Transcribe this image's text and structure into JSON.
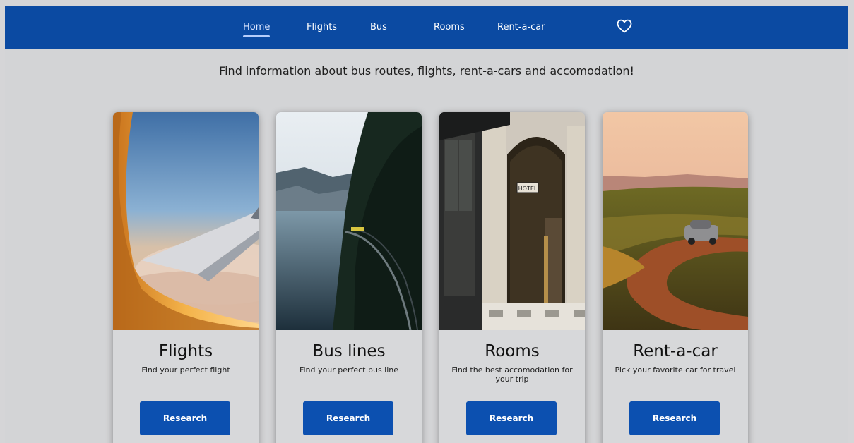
{
  "nav": {
    "items": [
      {
        "label": "Home",
        "active": true
      },
      {
        "label": "Flights",
        "active": false
      },
      {
        "label": "Bus",
        "active": false
      },
      {
        "label": "Rooms",
        "active": false
      },
      {
        "label": "Rent-a-car",
        "active": false
      }
    ],
    "favorites_icon": "heart-outline-icon"
  },
  "tagline": "Find information about bus routes, flights, rent-a-cars and accomodation!",
  "cards": [
    {
      "title": "Flights",
      "description": "Find your perfect flight",
      "button": "Research",
      "image": "airplane-window-photo"
    },
    {
      "title": "Bus lines",
      "description": "Find your perfect bus line",
      "button": "Research",
      "image": "lakeside-road-photo"
    },
    {
      "title": "Rooms",
      "description": "Find the best accomodation for your trip",
      "button": "Research",
      "image": "hotel-entrance-photo"
    },
    {
      "title": "Rent-a-car",
      "description": "Pick your favorite car for travel",
      "button": "Research",
      "image": "car-on-road-photo"
    }
  ],
  "colors": {
    "nav_bg": "#0b4aa2",
    "button_bg": "#0c50b0",
    "page_bg": "#d3d4d6",
    "card_bg": "#d7d8da"
  }
}
